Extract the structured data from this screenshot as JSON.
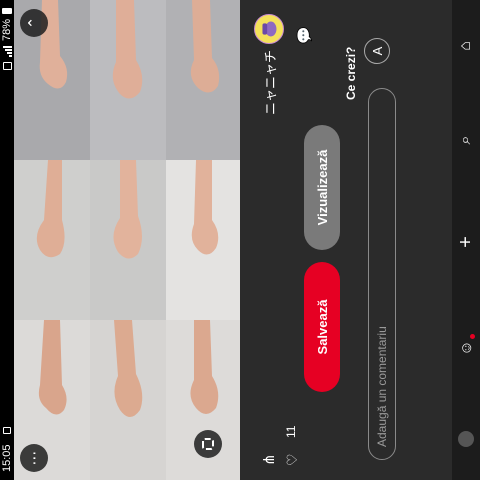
{
  "status": {
    "time": "15:05",
    "battery": "78%"
  },
  "pin": {
    "username": "ニャニャチ",
    "view_label": "Vizualizează",
    "save_label": "Salvează",
    "like_count": "11"
  },
  "comments": {
    "prompt": "Ce crezi?",
    "avatar_initial": "A",
    "placeholder": "Adaugă un comentariu"
  },
  "icons": {
    "back": "chevron-up-icon",
    "more": "more-dots-icon",
    "lens": "visual-search-icon",
    "share": "share-icon",
    "like": "heart-icon",
    "chat": "chat-bubble-icon",
    "nav": [
      "home-icon",
      "search-icon",
      "plus-icon",
      "messages-icon",
      "profile-icon"
    ]
  },
  "colors": {
    "save": "#e60023",
    "panel": "#2b2b2b",
    "view": "#7a7a7a"
  }
}
